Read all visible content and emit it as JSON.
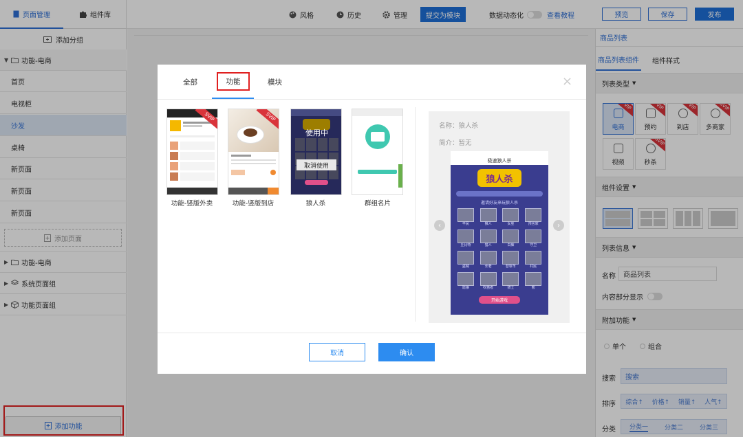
{
  "left_panel": {
    "tab_page_manage": "页面管理",
    "tab_components": "组件库",
    "add_group": "添加分组",
    "group_ecommerce": "功能-电商",
    "pages": [
      "首页",
      "电视柜",
      "沙发",
      "桌椅",
      "新页面",
      "新页面",
      "新页面"
    ],
    "add_page": "添加页面",
    "collapsed_groups": [
      "功能-电商",
      "系统页面组",
      "功能页面组"
    ],
    "add_feature": "添加功能"
  },
  "toolbar": {
    "style": "风格",
    "history": "历史",
    "manage": "管理",
    "submit_as_module": "提交为模块",
    "data_dynamic": "数据动态化",
    "view_tutorial": "查看教程",
    "preview": "预览",
    "save": "保存",
    "publish": "发布"
  },
  "right_panel": {
    "header": "商品列表",
    "tab_component": "商品列表组件",
    "tab_style": "组件样式",
    "list_type_title": "列表类型",
    "list_types": [
      {
        "label": "电商",
        "vip": true
      },
      {
        "label": "预约",
        "vip": true
      },
      {
        "label": "到店",
        "vip": true
      },
      {
        "label": "多商家",
        "vip": true
      },
      {
        "label": "视频",
        "vip": false
      },
      {
        "label": "秒杀",
        "vip": true
      }
    ],
    "vip_badge": "VIP",
    "svip_badge": "SVIP",
    "component_settings": "组件设置",
    "list_info": "列表信息",
    "name_label": "名称",
    "name_value": "商品列表",
    "partial_display": "内容部分显示",
    "extra_features": "附加功能",
    "single": "单个",
    "combo": "组合",
    "search_label": "搜索",
    "search_value": "搜索",
    "sort_label": "排序",
    "sort_options": [
      "综合↑",
      "价格↑",
      "销量↑",
      "人气↑"
    ],
    "category_label": "分类",
    "category_options": [
      "分类一",
      "分类二",
      "分类三"
    ]
  },
  "modal": {
    "tabs": [
      "全部",
      "功能",
      "模块"
    ],
    "active_tab": "功能",
    "templates": [
      {
        "label": "功能-竖版外卖",
        "badge": "SVIP"
      },
      {
        "label": "功能-竖版到店",
        "badge": "SVIP"
      },
      {
        "label": "狼人杀",
        "badge": "",
        "status": "使用中",
        "action": "取消使用"
      },
      {
        "label": "群组名片",
        "badge": ""
      }
    ],
    "detail": {
      "name_line": "名称：狼人杀",
      "intro_line": "简介：暂无",
      "phone_title": "极速狼人杀",
      "game_logo": "狼人杀",
      "game_subtitle": "邀请好友来玩狼人杀",
      "start_button": "开始游戏",
      "role_names": [
        "平民",
        "狼人",
        "女巫",
        "预言家",
        "丘比特",
        "猎人",
        "白痴",
        "守卫",
        "盗贼",
        "长老",
        "替罪羊",
        "村民",
        "隐狼",
        "吹笛者",
        "骑士",
        "熊"
      ]
    },
    "cancel": "取消",
    "confirm": "确认",
    "accent_color": "#2d8cf0",
    "highlight_color": "#e02020"
  }
}
